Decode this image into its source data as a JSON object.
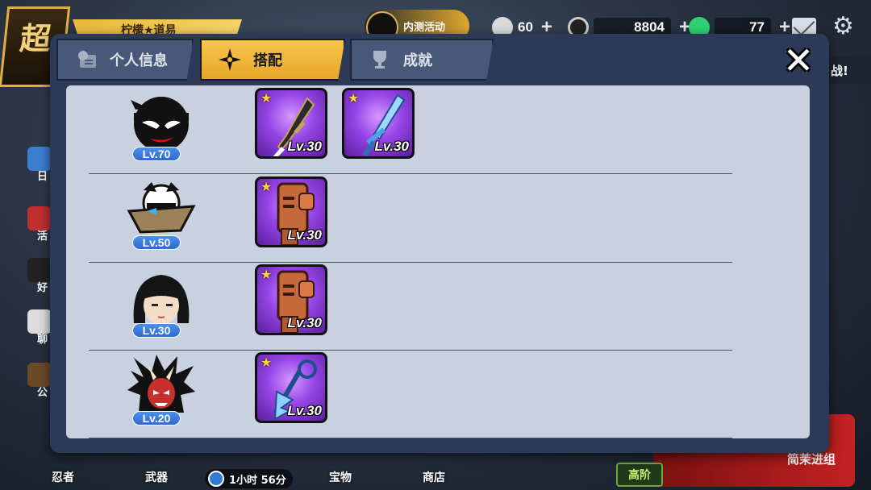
{
  "hud": {
    "logo_char": "超",
    "banner_text": "柠檬★道易",
    "event_label": "内测活动",
    "resources": [
      {
        "icon": "coin-icon",
        "value": "60"
      },
      {
        "icon": "gem-icon",
        "value": "8804"
      },
      {
        "icon": "energy-icon",
        "value": "77"
      }
    ],
    "challenge_text": "战!",
    "side_labels": [
      "日",
      "活",
      "好",
      "聊",
      "公"
    ],
    "bottom_nav": [
      "忍者",
      "武器",
      "宝物",
      "商店"
    ],
    "timer_text": "1小时 56分",
    "advanced_label": "高阶",
    "red_panel_text": "简茉进组"
  },
  "modal": {
    "tabs": [
      {
        "label": "个人信息",
        "icon": "profile-card-icon",
        "active": false
      },
      {
        "label": "搭配",
        "icon": "shuriken-icon",
        "active": true
      },
      {
        "label": "成就",
        "icon": "trophy-icon",
        "active": false
      }
    ],
    "close_icon": "close-icon",
    "loadouts": [
      {
        "character": "black-ninja",
        "level": "Lv.70",
        "weapons": [
          {
            "type": "dark-dagger",
            "level": "Lv.30"
          },
          {
            "type": "ice-sword",
            "level": "Lv.30"
          }
        ]
      },
      {
        "character": "straw-hat-ninja",
        "level": "Lv.50",
        "weapons": [
          {
            "type": "bronze-gauntlet",
            "level": "Lv.30"
          }
        ]
      },
      {
        "character": "black-hair-girl",
        "level": "Lv.30",
        "weapons": [
          {
            "type": "bronze-gauntlet",
            "level": "Lv.30"
          }
        ]
      },
      {
        "character": "oni-mask-ninja",
        "level": "Lv.20",
        "weapons": [
          {
            "type": "blue-staff",
            "level": "Lv.30"
          }
        ]
      }
    ]
  }
}
